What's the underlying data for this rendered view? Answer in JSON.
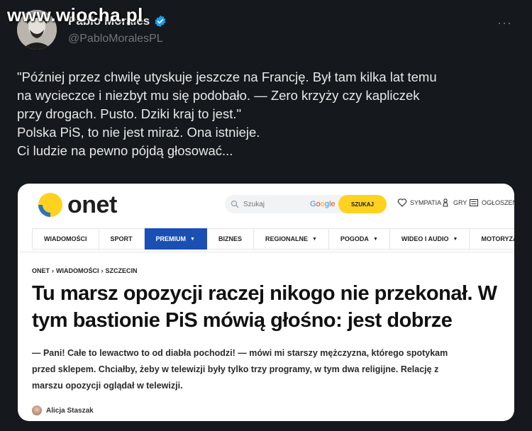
{
  "watermark": "www.wiocha.pl",
  "tweet": {
    "display_name": "Pablo Morales",
    "handle": "@PabloMoralesPL",
    "more_label": "···",
    "text_lines": [
      "\"Później przez chwilę utyskuje jeszcze na Francję. Był tam kilka lat temu",
      "na wycieczce i niezbyt mu się podobało. — Zero krzyży czy kapliczek",
      "przy drogach. Pusto. Dziki kraj to jest.\"",
      "Polska PiS, to nie jest miraż. Ona istnieje.",
      "Ci ludzie na pewno pójdą głosować..."
    ]
  },
  "card": {
    "logo_text": "onet",
    "search_placeholder": "Szukaj",
    "search_provider": "Google",
    "search_button": "SZUKAJ",
    "utils": {
      "sympatia": "SYMPATIA",
      "gry": "GRY",
      "ogloszenia": "OGŁOSZENI"
    },
    "nav": [
      {
        "label": "WIADOMOŚCI",
        "caret": ""
      },
      {
        "label": "SPORT",
        "caret": ""
      },
      {
        "label": "PREMIUM",
        "caret": "▼"
      },
      {
        "label": "BIZNES",
        "caret": ""
      },
      {
        "label": "REGIONALNE",
        "caret": "▼"
      },
      {
        "label": "POGODA",
        "caret": "▼"
      },
      {
        "label": "WIDEO I AUDIO",
        "caret": "▼"
      },
      {
        "label": "MOTORYZACJA",
        "caret": "▼"
      }
    ],
    "breadcrumb": [
      "ONET",
      "›",
      "WIADOMOŚCI",
      "›",
      "SZCZECIN"
    ],
    "headline_lines": [
      "Tu marsz opozycji raczej nikogo nie przekonał. W",
      "tym bastionie PiS mówią głośno: jest dobrze"
    ],
    "lead_lines": [
      "— Pani! Całe to lewactwo to od diabła pochodzi! — mówi mi starszy mężczyzna, którego spotykam",
      "przed sklepem. Chciałby, żeby w telewizji były tylko trzy programy, w tym dwa religijne. Relację z",
      "marszu opozycji oglądał w telewizji."
    ],
    "author": "Alicja Staszak"
  },
  "colors": {
    "background": "#15181c",
    "verified": "#1d9bf0",
    "onet_yellow": "#ffd21f",
    "onet_blue": "#2a73c9",
    "premium_nav": "#1a4fb4"
  }
}
